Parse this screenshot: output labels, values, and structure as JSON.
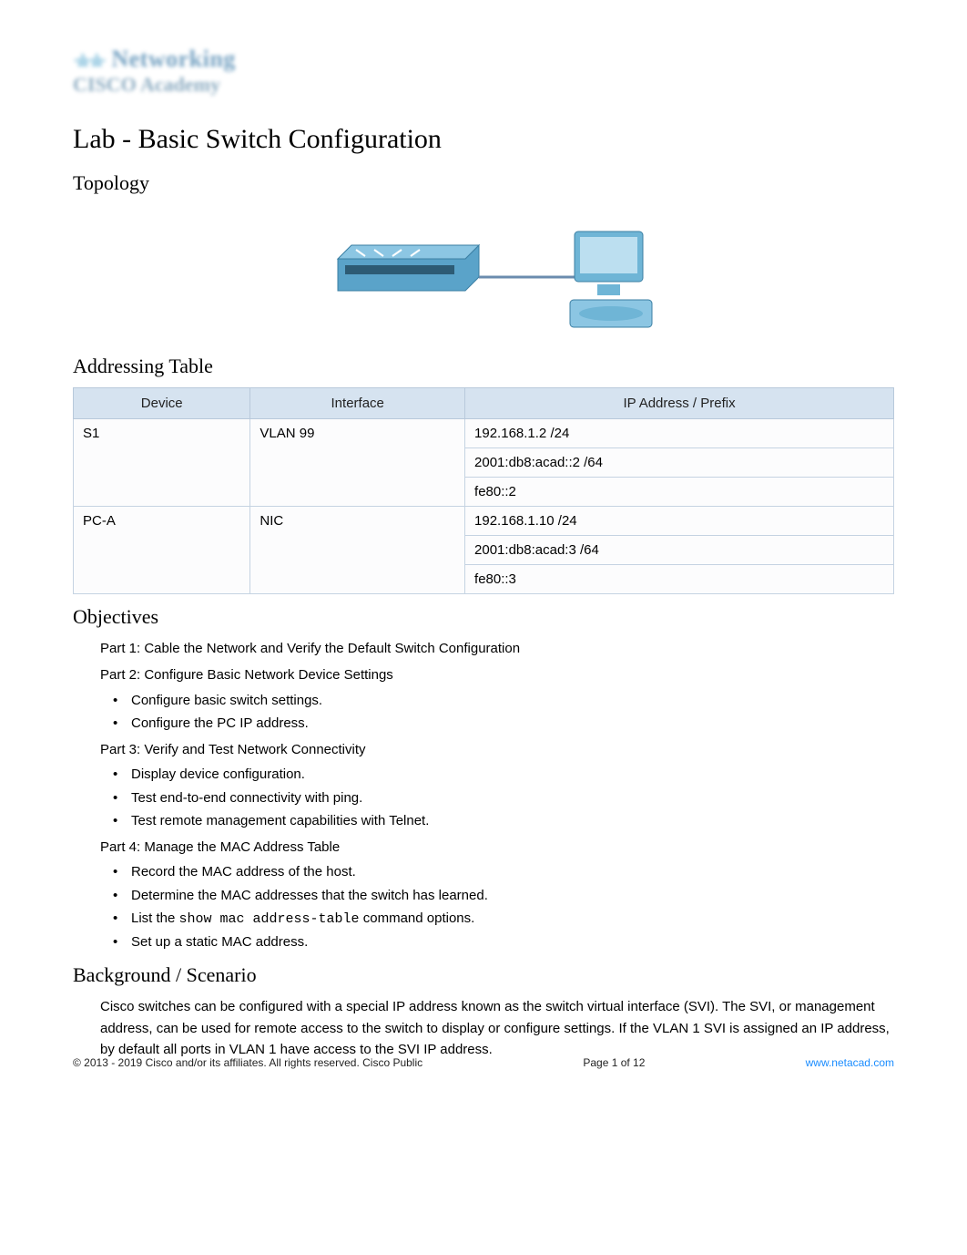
{
  "logo": {
    "line1_left": "·ılı·ılı·",
    "line1_right": "Networking",
    "line2_left": "CISCO",
    "line2_right": "Academy"
  },
  "title": "Lab - Basic Switch Configuration",
  "sections": {
    "topology": "Topology",
    "addressing": "Addressing Table",
    "objectives": "Objectives",
    "background": "Background / Scenario"
  },
  "addr_table": {
    "headers": [
      "Device",
      "Interface",
      "IP Address / Prefix"
    ],
    "rows": [
      {
        "device": "S1",
        "iface": "VLAN 99",
        "addrs": [
          "192.168.1.2 /24",
          "2001:db8:acad::2 /64",
          "fe80::2"
        ]
      },
      {
        "device": "PC-A",
        "iface": "NIC",
        "addrs": [
          "192.168.1.10 /24",
          "2001:db8:acad:3 /64",
          "fe80::3"
        ]
      }
    ]
  },
  "objectives": {
    "part1": "Part 1: Cable the Network and Verify the Default Switch Configuration",
    "part2": "Part 2: Configure Basic Network Device Settings",
    "part2_items": [
      "Configure basic switch settings.",
      "Configure the PC IP address."
    ],
    "part3": "Part 3: Verify and Test Network Connectivity",
    "part3_items": [
      "Display device configuration.",
      "Test end-to-end connectivity with ping.",
      "Test remote management capabilities with Telnet."
    ],
    "part4": "Part 4: Manage the MAC Address Table",
    "part4_items_pre": [
      "Record the MAC address of the host.",
      "Determine the MAC addresses that the switch has learned."
    ],
    "part4_item_cmd_pre": "List the ",
    "part4_item_cmd": "show mac address-table",
    "part4_item_cmd_post": " command options.",
    "part4_items_post": [
      "Set up a static MAC address."
    ]
  },
  "background_text": "Cisco switches can be configured with a special IP address known as the switch virtual interface (SVI). The SVI, or management address, can be used for remote access to the switch to display or configure settings. If the VLAN 1 SVI is assigned an IP address, by default all ports in VLAN 1 have access to the SVI IP address.",
  "footer": {
    "left": "© 2013 - 2019 Cisco and/or its affiliates. All rights reserved. Cisco Public",
    "center": "Page 1 of 12",
    "right": "www.netacad.com"
  }
}
